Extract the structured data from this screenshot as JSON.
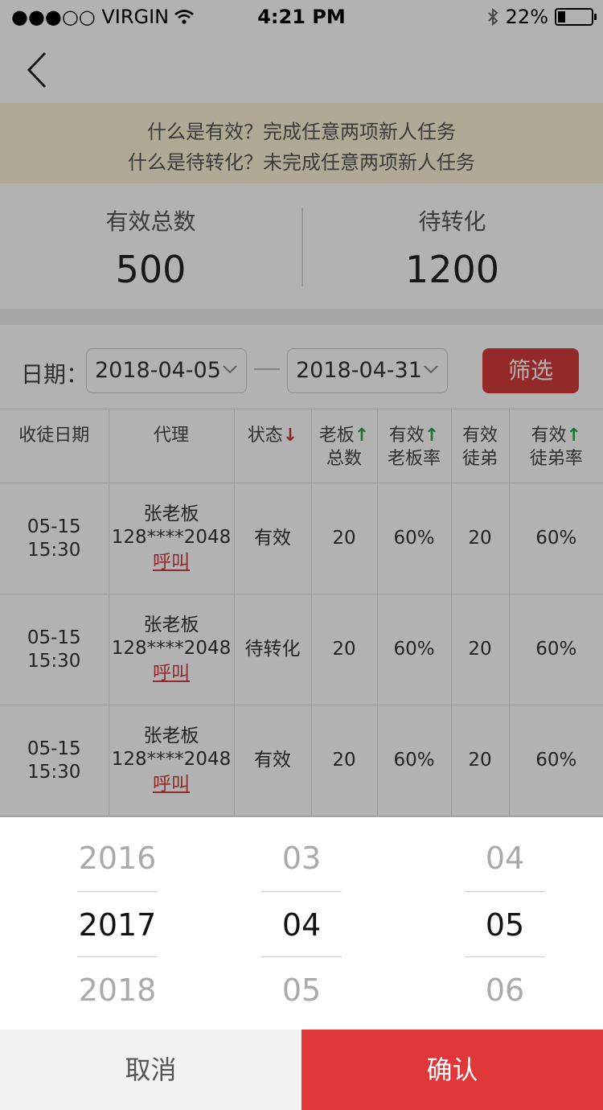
{
  "status_bar": {
    "carrier": "●●●○○ VIRGIN",
    "time": "4:21 PM",
    "battery": "22%",
    "battery_level": 0.22
  },
  "nav": {
    "back_icon": "chevron-left-icon"
  },
  "notice": {
    "line1": "什么是有效？完成任意两项新人任务",
    "line2": "什么是待转化？未完成任意两项新人任务"
  },
  "summary": {
    "valid_label": "有效总数",
    "valid_value": "500",
    "pending_label": "待转化",
    "pending_value": "1200"
  },
  "filter": {
    "label": "日期：",
    "start_date": "2018-04-05",
    "end_date": "2018-04-31",
    "button": "筛选"
  },
  "table": {
    "headers": {
      "date": "收徒日期",
      "agent": "代理",
      "status": "状态",
      "status_arrow": "↓",
      "boss_total_1": "老板",
      "boss_total_2": "总数",
      "valid_boss_rate_1": "有效",
      "valid_boss_rate_2": "老板率",
      "valid_disciple_1": "有效",
      "valid_disciple_2": "徒弟",
      "valid_disciple_rate_1": "有效",
      "valid_disciple_rate_2": "徒弟率",
      "up_arrow": "↑"
    },
    "rows": [
      {
        "date": "05-15",
        "time": "15:30",
        "name": "张老板",
        "phone": "128****2048",
        "call": "呼叫",
        "status": "有效",
        "boss_total": "20",
        "boss_rate": "60%",
        "disciples": "20",
        "disciple_rate": "60%"
      },
      {
        "date": "05-15",
        "time": "15:30",
        "name": "张老板",
        "phone": "128****2048",
        "call": "呼叫",
        "status": "待转化",
        "boss_total": "20",
        "boss_rate": "60%",
        "disciples": "20",
        "disciple_rate": "60%"
      },
      {
        "date": "05-15",
        "time": "15:30",
        "name": "张老板",
        "phone": "128****2048",
        "call": "呼叫",
        "status": "有效",
        "boss_total": "20",
        "boss_rate": "60%",
        "disciples": "20",
        "disciple_rate": "60%"
      }
    ]
  },
  "picker": {
    "year": [
      "2016",
      "2017",
      "2018"
    ],
    "month": [
      "03",
      "04",
      "05"
    ],
    "day": [
      "04",
      "05",
      "06"
    ]
  },
  "actions": {
    "cancel": "取消",
    "confirm": "确认"
  },
  "colors": {
    "accent": "#d43c3c",
    "valid": "#2aa34a",
    "notice_bg": "#fbf3d6"
  }
}
